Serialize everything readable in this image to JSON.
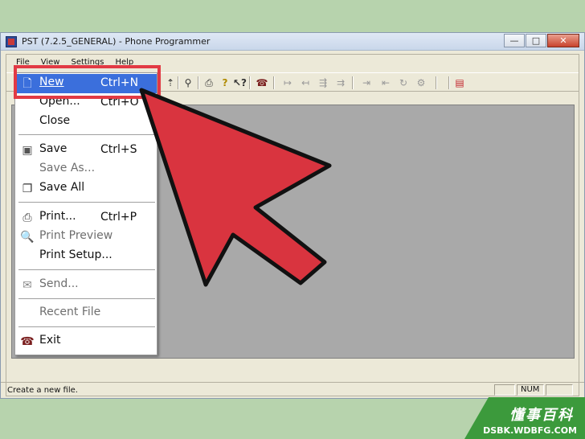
{
  "window": {
    "title": "PST (7.2.5_GENERAL) - Phone Programmer",
    "controls": {
      "minimize": "—",
      "maximize": "□",
      "close": "✕"
    }
  },
  "menubar": [
    "File",
    "View",
    "Settings",
    "Help"
  ],
  "file_menu": {
    "items": [
      {
        "label": "New",
        "shortcut": "Ctrl+N",
        "icon": "new-file-icon",
        "highlighted": true
      },
      {
        "label": "Open...",
        "shortcut": "Ctrl+O",
        "icon": ""
      },
      {
        "label": "Close",
        "shortcut": "",
        "icon": ""
      },
      {
        "label": "Save",
        "shortcut": "Ctrl+S",
        "icon": "floppy-disk-icon"
      },
      {
        "label": "Save As...",
        "shortcut": "",
        "icon": "",
        "disabled": true
      },
      {
        "label": "Save All",
        "shortcut": "",
        "icon": "save-all-icon"
      },
      {
        "label": "Print...",
        "shortcut": "Ctrl+P",
        "icon": "printer-icon"
      },
      {
        "label": "Print Preview",
        "shortcut": "",
        "icon": "print-preview-icon",
        "disabled": true
      },
      {
        "label": "Print Setup...",
        "shortcut": "",
        "icon": ""
      },
      {
        "label": "Send...",
        "shortcut": "",
        "icon": "envelope-icon",
        "disabled": true
      },
      {
        "label": "Recent File",
        "shortcut": "",
        "icon": "",
        "disabled": true
      },
      {
        "label": "Exit",
        "shortcut": "",
        "icon": "exit-icon"
      }
    ]
  },
  "statusbar": {
    "message": "Create a new file.",
    "num": "NUM"
  },
  "watermark": {
    "title": "懂事百科",
    "url": "DSBK.WDBFG.COM"
  },
  "colors": {
    "highlight": "#3b6fdc",
    "callout": "#e23a44",
    "arrow": "#d9343f"
  }
}
